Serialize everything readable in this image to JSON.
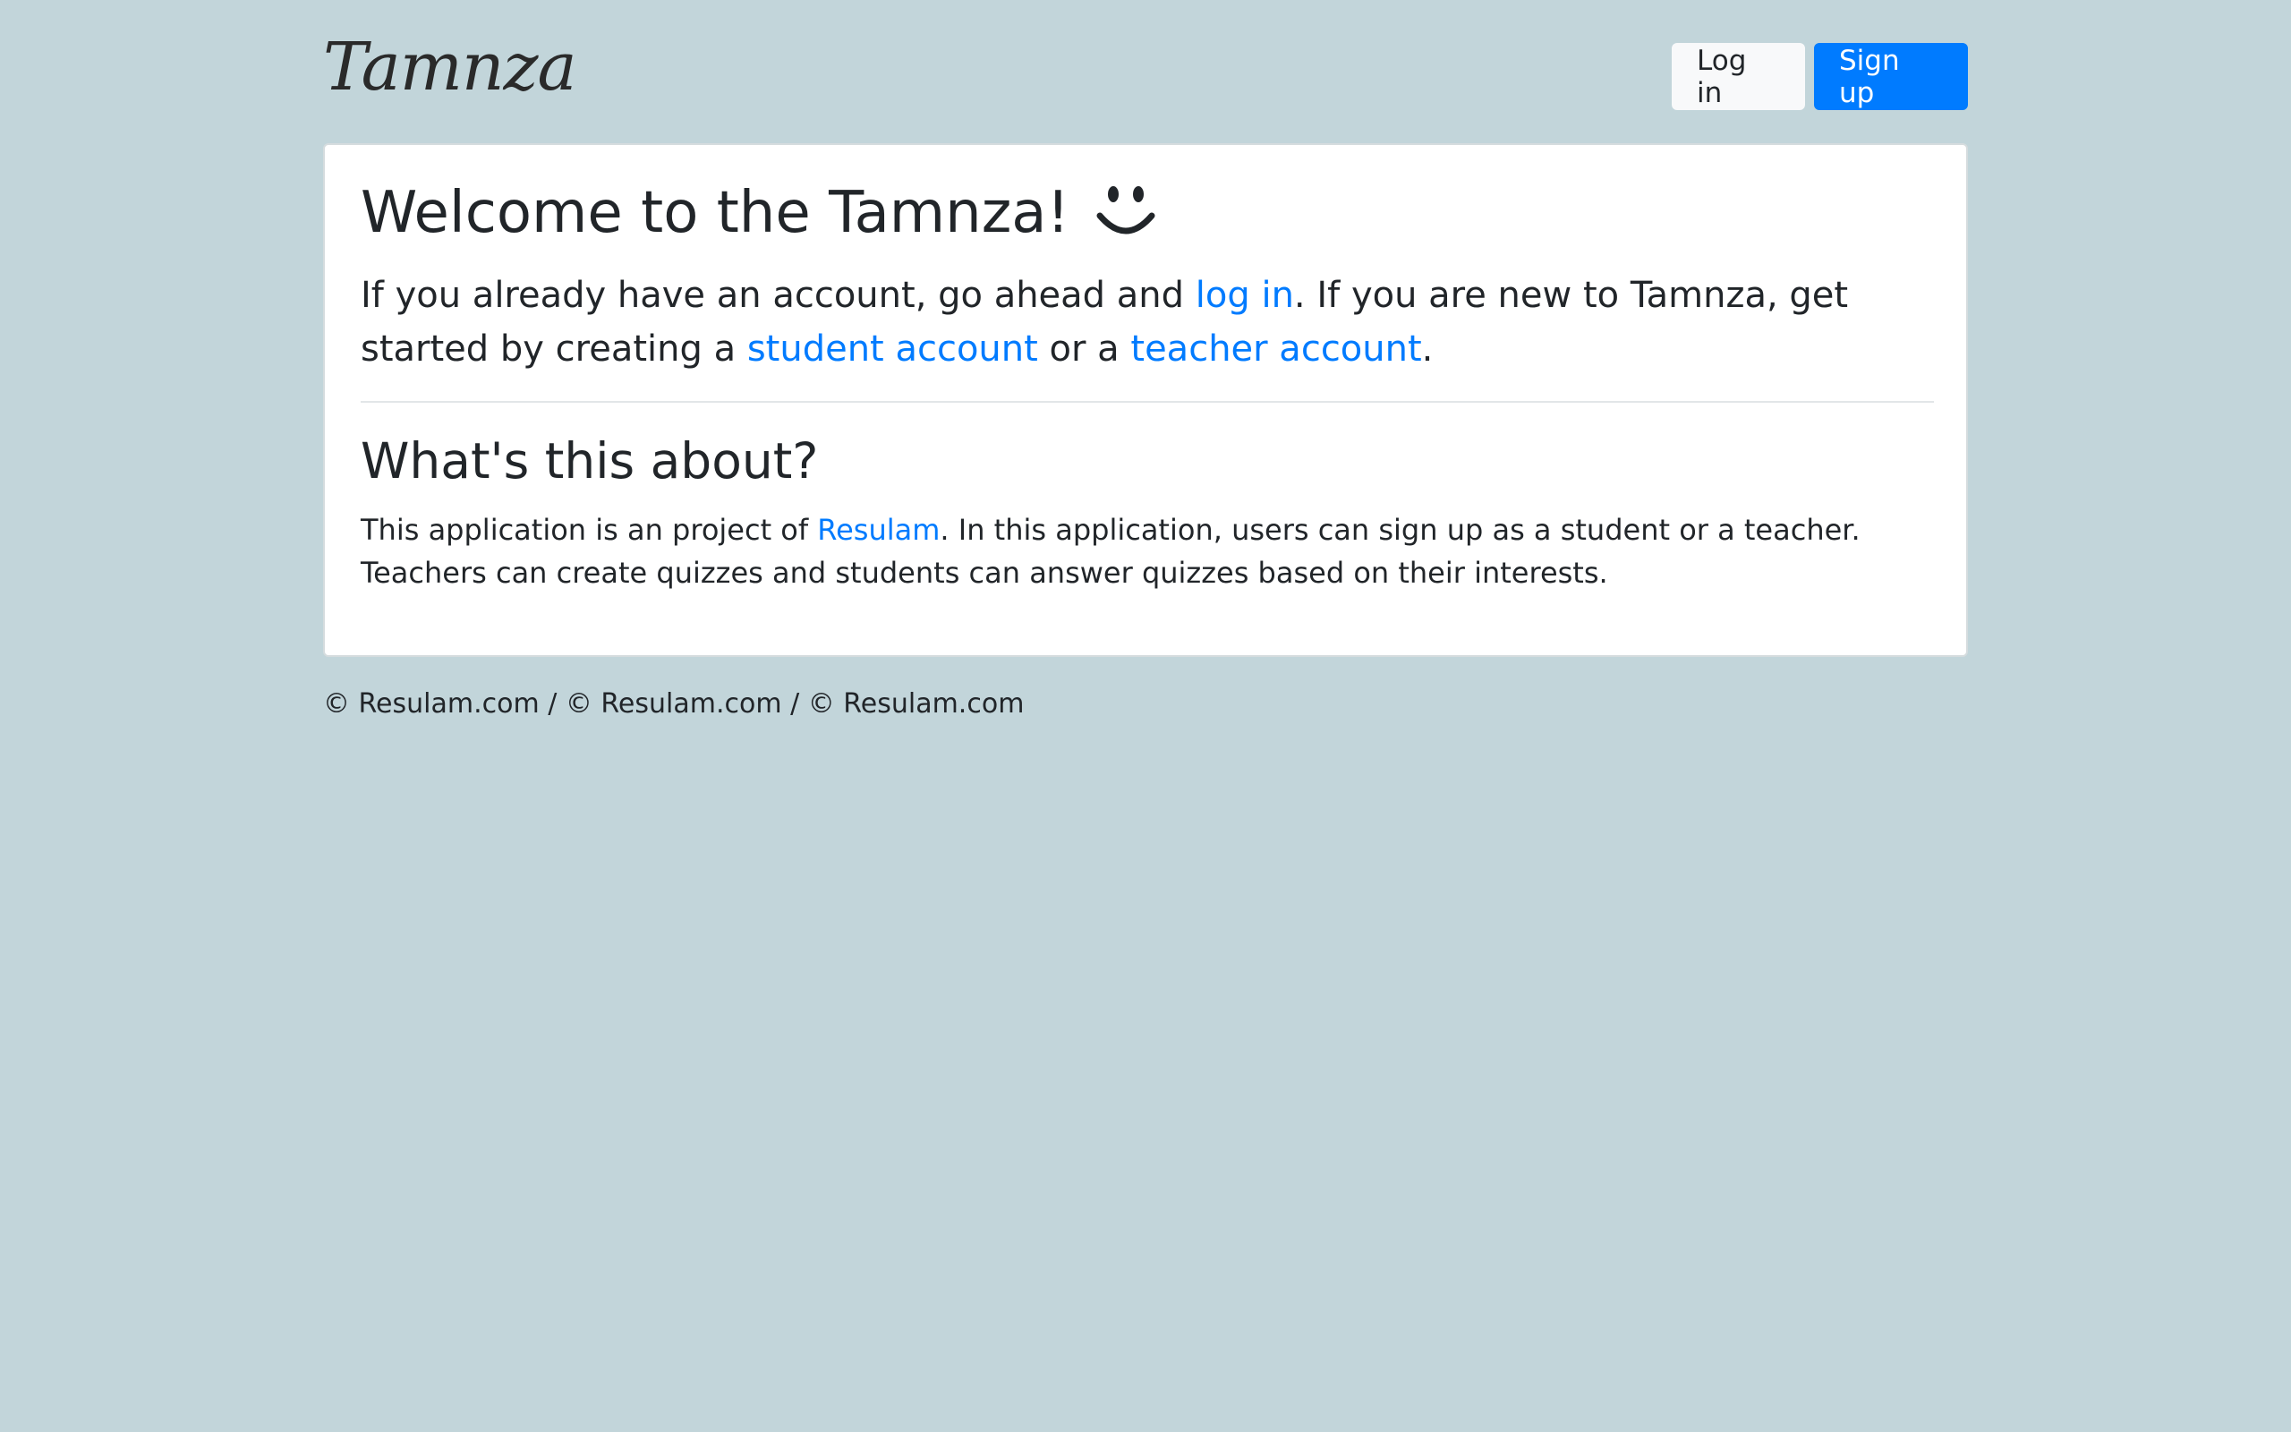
{
  "header": {
    "brand": "Tamnza",
    "login_label": "Log in",
    "signup_label": "Sign up"
  },
  "welcome": {
    "title": "Welcome to the Tamnza!",
    "intro_part1": "If you already have an account, go ahead and ",
    "login_link": "log in",
    "intro_part2": ". If you are new to Tamnza, get started by creating a ",
    "student_link": "student account",
    "intro_part3": " or a ",
    "teacher_link": "teacher account",
    "intro_part4": "."
  },
  "about": {
    "title": "What's this about?",
    "text_part1": "This application is an project of ",
    "resulam_link": "Resulam",
    "text_part2": ". In this application, users can sign up as a student or a teacher. Teachers can create quizzes and students can answer quizzes based on their interests."
  },
  "footer": {
    "text": "© Resulam.com / © Resulam.com / © Resulam.com"
  },
  "colors": {
    "background": "#c2d5da",
    "primary": "#007bff",
    "light": "#f8f9fa",
    "text": "#212529"
  },
  "icons": {
    "welcome_icon": "smile-icon"
  }
}
